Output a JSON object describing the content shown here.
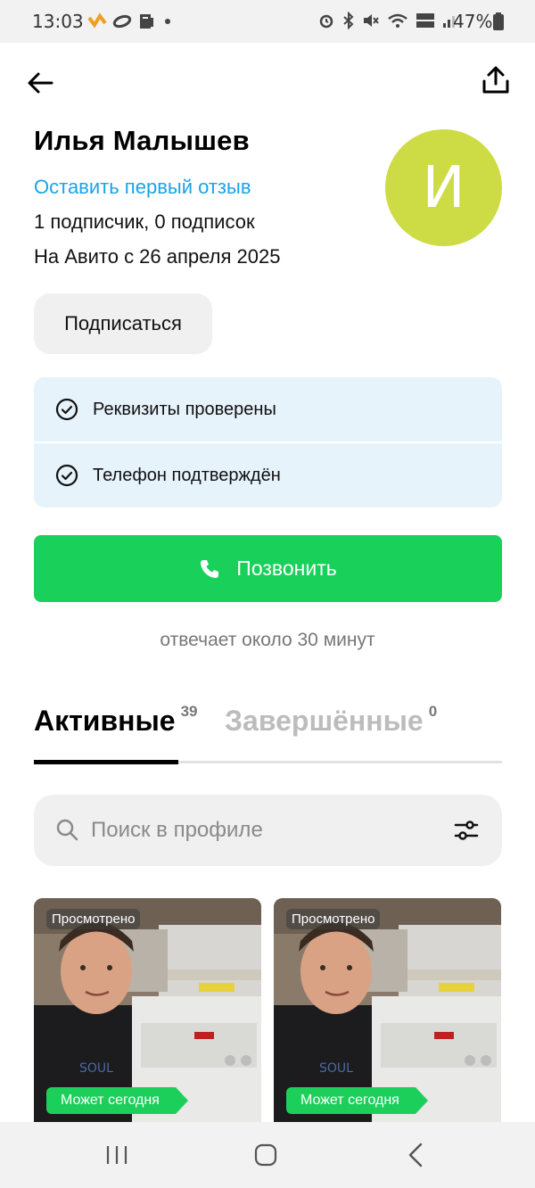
{
  "status_bar": {
    "time": "13:03",
    "battery": "47%",
    "icons": [
      "strava-icon",
      "infinity-icon",
      "clipboard-icon",
      "dot-icon",
      "alarm-icon",
      "bluetooth-icon",
      "mute-icon",
      "wifi-icon",
      "volte-icon",
      "signal-icon",
      "battery-icon"
    ]
  },
  "header": {
    "back_icon": "arrow-left-icon",
    "share_icon": "share-icon"
  },
  "profile": {
    "name": "Илья Малышев",
    "review_link": "Оставить первый отзыв",
    "subscribers": "1 подписчик, 0 подписок",
    "member_since": "На Авито с 26 апреля 2025",
    "avatar_letter": "И",
    "avatar_color": "#cddb45",
    "subscribe_label": "Подписаться"
  },
  "verifications": [
    {
      "label": "Реквизиты проверены",
      "icon": "check-circle-icon"
    },
    {
      "label": "Телефон подтверждён",
      "icon": "check-circle-icon"
    }
  ],
  "call": {
    "label": "Позвонить",
    "icon": "phone-icon",
    "color": "#19d05a",
    "response_time": "отвечает около 30 минут"
  },
  "tabs": [
    {
      "label": "Активные",
      "count": "39",
      "active": true
    },
    {
      "label": "Завершённые",
      "count": "0",
      "active": false
    }
  ],
  "search": {
    "placeholder": "Поиск в профиле",
    "icon": "search-icon",
    "filter_icon": "filter-sliders-icon"
  },
  "listings": [
    {
      "badge": "Просмотрено",
      "tag": "Может сегодня"
    },
    {
      "badge": "Просмотрено",
      "tag": "Может сегодня"
    }
  ],
  "nav_bar": {
    "icons": [
      "recent-apps-icon",
      "home-icon",
      "back-icon"
    ]
  }
}
